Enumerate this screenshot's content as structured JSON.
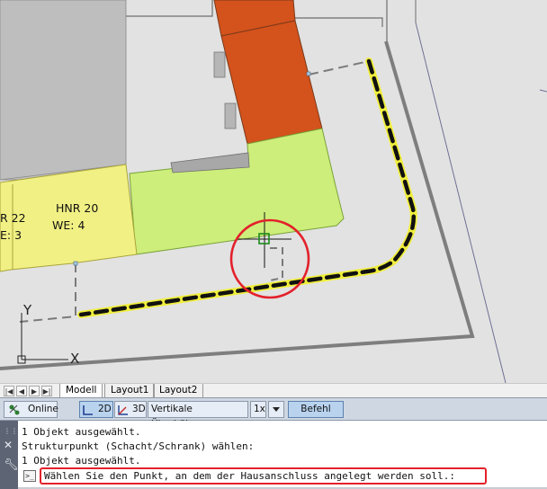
{
  "drawing": {
    "labels": {
      "hnr20": "HNR 20",
      "we4": "WE: 4",
      "hnr22_partial": "R 22",
      "we3_partial": "E: 3"
    },
    "ucs": {
      "y": "Y",
      "x": "X"
    }
  },
  "layout_tabs": {
    "nav": [
      "|◀",
      "◀",
      "▶",
      "▶|"
    ],
    "tabs": [
      "Modell",
      "Layout1",
      "Layout2"
    ],
    "active": "Modell"
  },
  "status_bar": {
    "online": "Online",
    "view_2d": "2D",
    "view_3d": "3D",
    "vertical_exaggeration_label": "Vertikale Überhöhung:",
    "vertical_exaggeration_value": "1x",
    "command_button": "Befehl"
  },
  "command_line": {
    "history": [
      "1 Objekt ausgewählt.",
      "Strukturpunkt (Schacht/Schrank) wählen:",
      "1 Objekt ausgewählt."
    ],
    "prompt": "Wählen Sie den Punkt, an dem der Hausanschluss angelegt werden soll.:"
  },
  "colors": {
    "canvas_bg": "#e2e2e2",
    "building_orange": "#d4521c",
    "parcel_green": "#cdee7a",
    "parcel_yellow": "#f1f084",
    "building_gray": "#bebebe",
    "highlight_red": "#e3212b",
    "selected_line_yellow": "#f0ee3c"
  },
  "icons": [
    "online-icon",
    "view-2d-icon",
    "view-3d-icon",
    "dropdown-arrow-icon",
    "close-icon",
    "settings-wrench-icon",
    "command-prompt-icon"
  ]
}
